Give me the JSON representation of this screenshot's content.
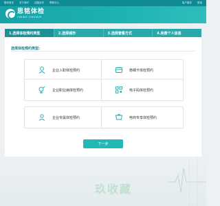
{
  "topbar": {
    "left_items": [
      "服务首页",
      "关于我们",
      "加盟合作",
      "帮助中心"
    ],
    "right_items": [
      "客户服务",
      "登录"
    ]
  },
  "logo": {
    "name": "思铭体检",
    "sub": "CIMING CHECKUP"
  },
  "steps": [
    {
      "label": "1.选择体检预约类型",
      "active": true
    },
    {
      "label": "2.选择城市",
      "active": false
    },
    {
      "label": "3.选择套餐方式",
      "active": false
    },
    {
      "label": "4.完善个人信息",
      "active": false
    }
  ],
  "section_title": "选择体检预约类型:",
  "options": [
    {
      "label": "企业入职体检预约",
      "icon": "employee-icon"
    },
    {
      "label": "慈细卡体检预约",
      "icon": "card-icon"
    },
    {
      "label": "企业职业病体检预约",
      "icon": "health-icon"
    },
    {
      "label": "电子码体检预约",
      "icon": "qr-icon"
    },
    {
      "label": "企业专属体检预约",
      "icon": "person-icon"
    },
    {
      "label": "电商专享体检预约",
      "icon": "shop-icon"
    }
  ],
  "next_button": "下一步",
  "watermark": "玖收藏",
  "colors": {
    "accent": "#1fb3b3",
    "step_active": "#1d8f96",
    "button": "#22b8b3",
    "icon": "#1aa8ad"
  }
}
